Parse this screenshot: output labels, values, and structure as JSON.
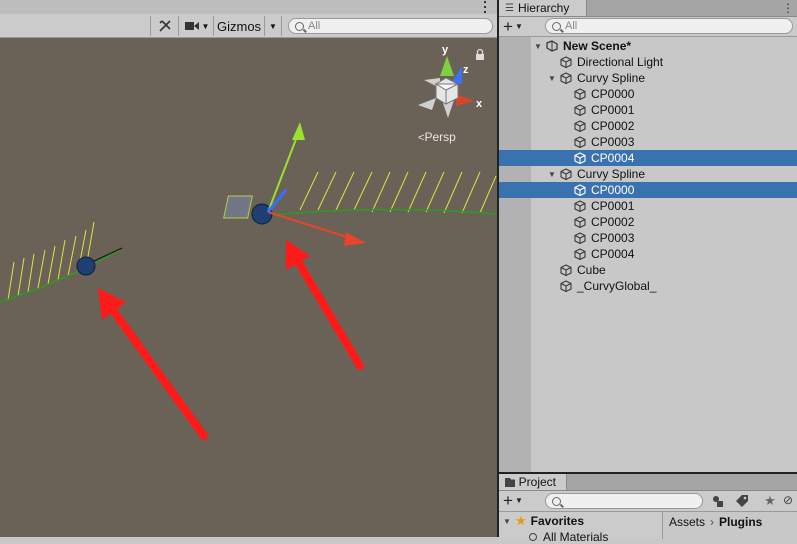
{
  "scene": {
    "toolbar": {
      "gizmos_label": "Gizmos",
      "search_placeholder": "All"
    },
    "persp_label": "Persp",
    "gizmo_axes": {
      "y": "y",
      "z": "z",
      "x": "x"
    }
  },
  "hierarchy": {
    "tab_label": "Hierarchy",
    "search_placeholder": "All",
    "items": [
      {
        "label": "New Scene*",
        "depth": 0,
        "expanded": true,
        "bold": true,
        "icon": "unity-scene-icon",
        "selected": false
      },
      {
        "label": "Directional Light",
        "depth": 1,
        "icon": "cube-icon",
        "selected": false
      },
      {
        "label": "Curvy Spline",
        "depth": 1,
        "expanded": true,
        "icon": "cube-icon",
        "selected": false
      },
      {
        "label": "CP0000",
        "depth": 2,
        "icon": "cube-icon",
        "selected": false
      },
      {
        "label": "CP0001",
        "depth": 2,
        "icon": "cube-icon",
        "selected": false
      },
      {
        "label": "CP0002",
        "depth": 2,
        "icon": "cube-icon",
        "selected": false
      },
      {
        "label": "CP0003",
        "depth": 2,
        "icon": "cube-icon",
        "selected": false
      },
      {
        "label": "CP0004",
        "depth": 2,
        "icon": "cube-icon",
        "selected": true
      },
      {
        "label": "Curvy Spline",
        "depth": 1,
        "expanded": true,
        "icon": "cube-icon",
        "selected": false
      },
      {
        "label": "CP0000",
        "depth": 2,
        "icon": "cube-icon",
        "selected": true
      },
      {
        "label": "CP0001",
        "depth": 2,
        "icon": "cube-icon",
        "selected": false
      },
      {
        "label": "CP0002",
        "depth": 2,
        "icon": "cube-icon",
        "selected": false
      },
      {
        "label": "CP0003",
        "depth": 2,
        "icon": "cube-icon",
        "selected": false
      },
      {
        "label": "CP0004",
        "depth": 2,
        "icon": "cube-icon",
        "selected": false
      },
      {
        "label": "Cube",
        "depth": 1,
        "icon": "cube-icon",
        "selected": false
      },
      {
        "label": "_CurvyGlobal_",
        "depth": 1,
        "icon": "cube-icon",
        "selected": false
      }
    ]
  },
  "project": {
    "tab_label": "Project",
    "favorites_label": "Favorites",
    "all_materials_label": "All Materials",
    "breadcrumb": [
      "Assets",
      "Plugins"
    ]
  },
  "colors": {
    "selection": "#3a72b0",
    "scene_bg": "#6a6157",
    "arrow_red": "#ff1a1a",
    "spline_green": "#3a9a2a"
  }
}
